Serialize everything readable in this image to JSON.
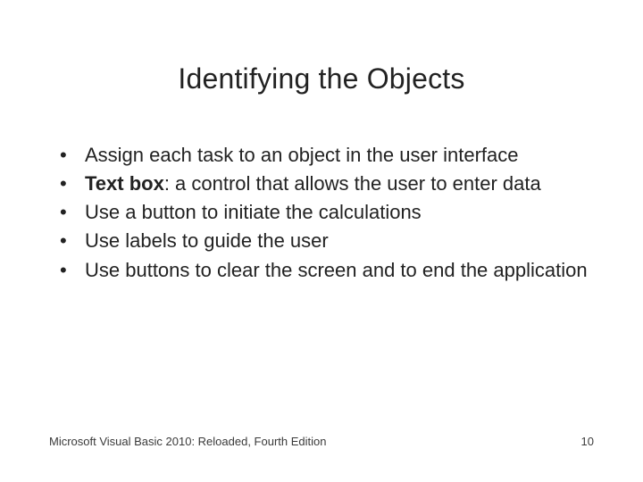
{
  "title": "Identifying the Objects",
  "bullets": {
    "b0": "Assign each task to an object in the user interface",
    "b1_term": "Text box",
    "b1_rest": ": a control that allows the user to enter data",
    "b2": "Use a button to initiate the calculations",
    "b3": "Use labels to guide the user",
    "b4": "Use buttons to clear the screen and to end the application"
  },
  "footer": {
    "source": "Microsoft Visual Basic 2010: Reloaded, Fourth Edition",
    "page": "10"
  }
}
